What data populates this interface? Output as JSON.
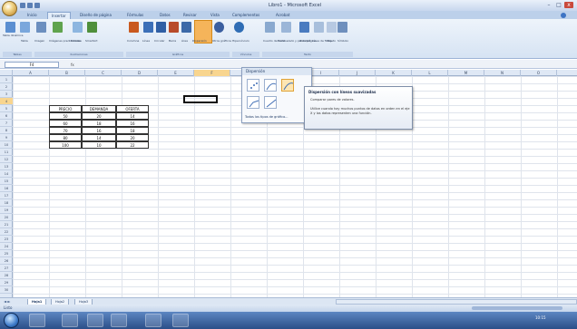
{
  "window": {
    "title": "Libro1 - Microsoft Excel",
    "min": "–",
    "max": "□",
    "close": "x"
  },
  "tabs": [
    {
      "label": "Inicio",
      "active": false
    },
    {
      "label": "Insertar",
      "active": true
    },
    {
      "label": "Diseño de página",
      "active": false
    },
    {
      "label": "Fórmulas",
      "active": false
    },
    {
      "label": "Datos",
      "active": false
    },
    {
      "label": "Revisar",
      "active": false
    },
    {
      "label": "Vista",
      "active": false
    },
    {
      "label": "Complementos",
      "active": false
    },
    {
      "label": "Acrobat",
      "active": false
    }
  ],
  "ribbon": {
    "buttons": [
      "Tabla dinámica",
      "Tabla",
      "Imagen",
      "Imágenes prediseñadas",
      "Formas",
      "SmartArt",
      "Columna",
      "Línea",
      "Circular",
      "Barra",
      "Área",
      "Dispersión",
      "Otros gráficos",
      "Hipervínculo",
      "Cuadro de texto",
      "Encabezado y pie de página",
      "WordArt",
      "Línea de firma",
      "Objeto",
      "Símbolo"
    ],
    "groups": [
      "Tablas",
      "Ilustraciones",
      "Gráficos",
      "Vínculos",
      "Texto"
    ]
  },
  "formula": {
    "namebox": "F4",
    "fx": "fx"
  },
  "columns": [
    "A",
    "B",
    "C",
    "D",
    "E",
    "F",
    "G",
    "H",
    "I",
    "J",
    "K",
    "L",
    "M",
    "N",
    "O"
  ],
  "rows": [
    "1",
    "2",
    "3",
    "4",
    "5",
    "6",
    "7",
    "8",
    "9",
    "10",
    "11",
    "12",
    "13",
    "14",
    "15",
    "16",
    "17",
    "18",
    "19",
    "20",
    "21",
    "22",
    "23",
    "24",
    "25",
    "26",
    "27",
    "28",
    "29",
    "30"
  ],
  "table": {
    "headers": [
      "PRECIO",
      "DEMANDA",
      "OFERTA"
    ],
    "rows": [
      [
        "50",
        "20",
        "14"
      ],
      [
        "60",
        "18",
        "16"
      ],
      [
        "70",
        "16",
        "18"
      ],
      [
        "80",
        "14",
        "20"
      ],
      [
        "100",
        "10",
        "22"
      ]
    ]
  },
  "dropdown": {
    "header": "Dispersión",
    "link": "Todos los tipos de gráfico..."
  },
  "tooltip": {
    "title": "Dispersión con líneas suavizadas",
    "sub": "Comparar pares de valores.",
    "body": "Utilice cuando hay muchos puntos de datos en orden en el eje X y los datos representen una función."
  },
  "sheets": [
    "Hoja1",
    "Hoja2",
    "Hoja3"
  ],
  "status": "Listo",
  "clock": "10:15"
}
